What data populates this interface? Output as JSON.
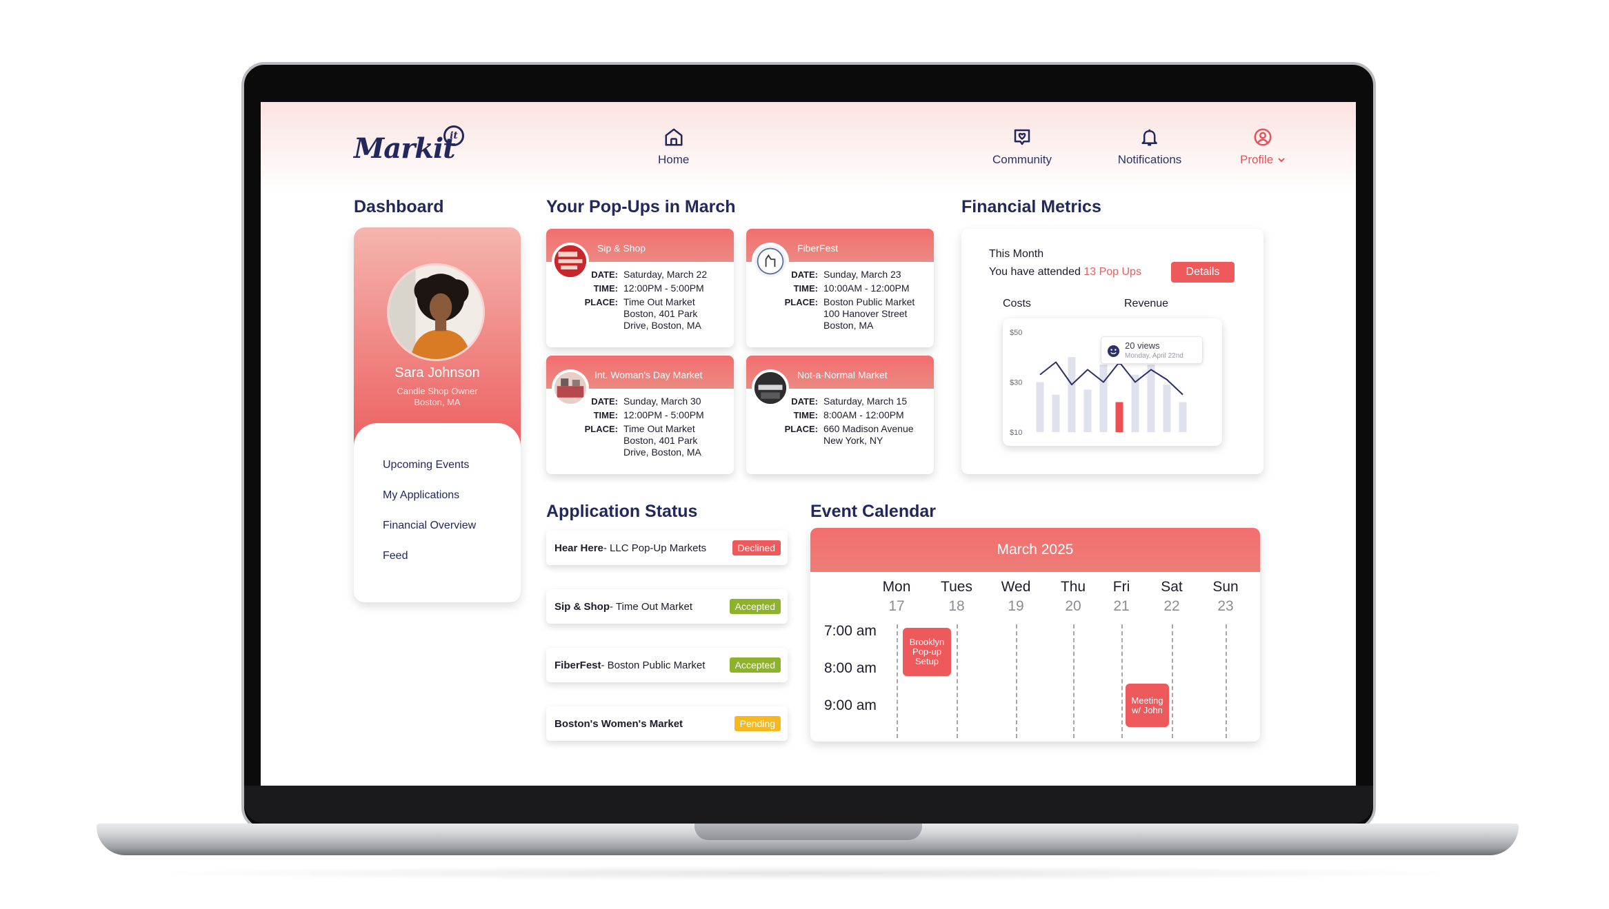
{
  "app": {
    "logo": "Markit",
    "logo_mark": "it"
  },
  "nav": {
    "home": "Home",
    "community": "Community",
    "notifications": "Notifications",
    "profile": "Profile"
  },
  "dashboard": {
    "title": "Dashboard",
    "name": "Sara Johnson",
    "role": "Candle Shop Owner",
    "location": "Boston, MA",
    "menu": [
      "Upcoming Events",
      "My Applications",
      "Financial Overview",
      "Feed"
    ]
  },
  "popups": {
    "title": "Your Pop-Ups in March",
    "labels": {
      "date": "DATE:",
      "time": "TIME:",
      "place": "PLACE:"
    },
    "items": [
      {
        "name": "Sip & Shop",
        "date": "Saturday, March 22",
        "time": "12:00PM - 5:00PM",
        "place": [
          "Time Out Market",
          "Boston, 401 Park",
          "Drive, Boston, MA"
        ]
      },
      {
        "name": "FiberFest",
        "date": "Sunday, March 23",
        "time": "10:00AM - 12:00PM",
        "place": [
          "Boston Public Market",
          "100 Hanover Street",
          "Boston, MA"
        ]
      },
      {
        "name": "Int. Woman's Day Market",
        "date": "Sunday, March 30",
        "time": "12:00PM - 5:00PM",
        "place": [
          "Time Out Market",
          "Boston, 401 Park",
          "Drive, Boston, MA"
        ]
      },
      {
        "name": "Not-a-Normal Market",
        "date": "Saturday, March 15",
        "time": "8:00AM - 12:00PM",
        "place": [
          "660 Madison Avenue",
          "New York, NY"
        ]
      }
    ]
  },
  "financial": {
    "title": "Financial Metrics",
    "period": "This Month",
    "attended_prefix": "You have attended",
    "attended_highlight": "13 Pop Ups",
    "details_button": "Details",
    "costs_label": "Costs",
    "revenue_label": "Revenue",
    "tooltip_views": "20 views",
    "tooltip_date": "Monday, April 22nd"
  },
  "chart_data": {
    "type": "bar",
    "yticks": [
      "$50",
      "$30",
      "$10"
    ],
    "ylim": [
      10,
      50
    ],
    "bars": [
      30,
      25,
      40,
      27,
      37,
      22,
      33,
      37,
      29,
      22
    ],
    "line": [
      33,
      38,
      29,
      35,
      30,
      38,
      30,
      35,
      31,
      25
    ],
    "highlight_index": 5,
    "grid": false
  },
  "applications": {
    "title": "Application Status",
    "items": [
      {
        "name": "Hear Here",
        "sub": " - LLC Pop-Up Markets",
        "status": "Declined",
        "color": "#ee5a5c"
      },
      {
        "name": "Sip & Shop",
        "sub": " - Time Out Market",
        "status": "Accepted",
        "color": "#8db22b"
      },
      {
        "name": "FiberFest",
        "sub": " - Boston Public Market",
        "status": "Accepted",
        "color": "#8db22b"
      },
      {
        "name": "Boston's Women's Market",
        "sub": "",
        "status": "Pending",
        "color": "#f7b81e"
      }
    ]
  },
  "calendar": {
    "title": "Event Calendar",
    "month": "March 2025",
    "days": [
      {
        "d": "Mon",
        "n": "17"
      },
      {
        "d": "Tues",
        "n": "18"
      },
      {
        "d": "Wed",
        "n": "19"
      },
      {
        "d": "Thu",
        "n": "20"
      },
      {
        "d": "Fri",
        "n": "21"
      },
      {
        "d": "Sat",
        "n": "22"
      },
      {
        "d": "Sun",
        "n": "23"
      }
    ],
    "times": [
      "7:00 am",
      "8:00 am",
      "9:00 am"
    ],
    "events": [
      {
        "title": "Brooklyn Pop-up Setup",
        "lines": [
          "Brooklyn",
          "Pop-up",
          "Setup"
        ]
      },
      {
        "title": "Meeting w/ John",
        "lines": [
          "Meeting",
          "w/ John"
        ]
      }
    ]
  },
  "colors": {
    "accent": "#ee5a5c",
    "navy": "#23285c",
    "accepted": "#8db22b",
    "pending": "#f7b81e"
  }
}
